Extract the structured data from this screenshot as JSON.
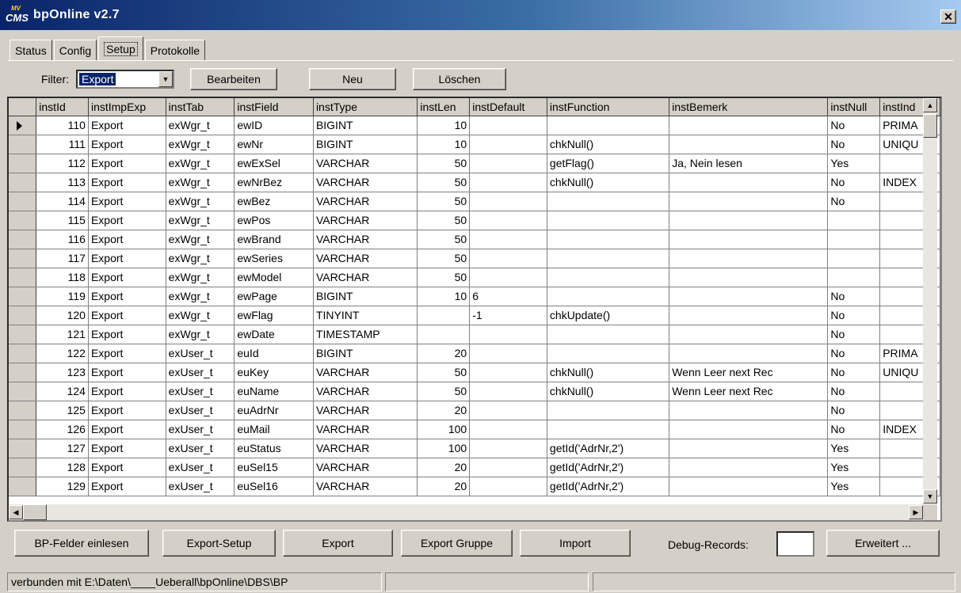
{
  "window": {
    "title": "bpOnline v2.7",
    "close_glyph": "✕",
    "logo_text": "CMS",
    "logo_top": "MV"
  },
  "tabs": [
    "Status",
    "Config",
    "Setup",
    "Protokolle"
  ],
  "toolbar": {
    "filter_label": "Filter:",
    "filter_value": "Export",
    "edit_label": "Bearbeiten",
    "new_label": "Neu",
    "delete_label": "Löschen"
  },
  "grid": {
    "columns": [
      "instId",
      "instImpExp",
      "instTab",
      "instField",
      "instType",
      "instLen",
      "instDefault",
      "instFunction",
      "instBemerk",
      "instNull",
      "instInd"
    ],
    "rows": [
      [
        "110",
        "Export",
        "exWgr_t",
        "ewID",
        "BIGINT",
        "10",
        "",
        "",
        "",
        "No",
        "PRIMA"
      ],
      [
        "111",
        "Export",
        "exWgr_t",
        "ewNr",
        "BIGINT",
        "10",
        "",
        "chkNull()",
        "",
        "No",
        "UNIQU"
      ],
      [
        "112",
        "Export",
        "exWgr_t",
        "ewExSel",
        "VARCHAR",
        "50",
        "",
        "getFlag()",
        "Ja, Nein lesen",
        "Yes",
        ""
      ],
      [
        "113",
        "Export",
        "exWgr_t",
        "ewNrBez",
        "VARCHAR",
        "50",
        "",
        "chkNull()",
        "",
        "No",
        "INDEX"
      ],
      [
        "114",
        "Export",
        "exWgr_t",
        "ewBez",
        "VARCHAR",
        "50",
        "",
        "",
        "",
        "No",
        ""
      ],
      [
        "115",
        "Export",
        "exWgr_t",
        "ewPos",
        "VARCHAR",
        "50",
        "",
        "",
        "",
        "",
        ""
      ],
      [
        "116",
        "Export",
        "exWgr_t",
        "ewBrand",
        "VARCHAR",
        "50",
        "",
        "",
        "",
        "",
        ""
      ],
      [
        "117",
        "Export",
        "exWgr_t",
        "ewSeries",
        "VARCHAR",
        "50",
        "",
        "",
        "",
        "",
        ""
      ],
      [
        "118",
        "Export",
        "exWgr_t",
        "ewModel",
        "VARCHAR",
        "50",
        "",
        "",
        "",
        "",
        ""
      ],
      [
        "119",
        "Export",
        "exWgr_t",
        "ewPage",
        "BIGINT",
        "10",
        "6",
        "",
        "",
        "No",
        ""
      ],
      [
        "120",
        "Export",
        "exWgr_t",
        "ewFlag",
        "TINYINT",
        "",
        "-1",
        "chkUpdate()",
        "",
        "No",
        ""
      ],
      [
        "121",
        "Export",
        "exWgr_t",
        "ewDate",
        "TIMESTAMP",
        "",
        "",
        "",
        "",
        "No",
        ""
      ],
      [
        "122",
        "Export",
        "exUser_t",
        "euId",
        "BIGINT",
        "20",
        "",
        "",
        "",
        "No",
        "PRIMA"
      ],
      [
        "123",
        "Export",
        "exUser_t",
        "euKey",
        "VARCHAR",
        "50",
        "",
        "chkNull()",
        "Wenn Leer next Rec",
        "No",
        "UNIQU"
      ],
      [
        "124",
        "Export",
        "exUser_t",
        "euName",
        "VARCHAR",
        "50",
        "",
        "chkNull()",
        "Wenn Leer next Rec",
        "No",
        ""
      ],
      [
        "125",
        "Export",
        "exUser_t",
        "euAdrNr",
        "VARCHAR",
        "20",
        "",
        "",
        "",
        "No",
        ""
      ],
      [
        "126",
        "Export",
        "exUser_t",
        "euMail",
        "VARCHAR",
        "100",
        "",
        "",
        "",
        "No",
        "INDEX"
      ],
      [
        "127",
        "Export",
        "exUser_t",
        "euStatus",
        "VARCHAR",
        "100",
        "",
        "getId('AdrNr,2')",
        "",
        "Yes",
        ""
      ],
      [
        "128",
        "Export",
        "exUser_t",
        "euSel15",
        "VARCHAR",
        "20",
        "",
        "getId('AdrNr,2')",
        "",
        "Yes",
        ""
      ],
      [
        "129",
        "Export",
        "exUser_t",
        "euSel16",
        "VARCHAR",
        "20",
        "",
        "getId('AdrNr,2')",
        "",
        "Yes",
        ""
      ]
    ]
  },
  "bottom": {
    "read_fields_label": "BP-Felder einlesen",
    "export_setup_label": "Export-Setup",
    "export_label": "Export",
    "export_group_label": "Export Gruppe",
    "import_label": "Import",
    "debug_label": "Debug-Records:",
    "debug_value": "",
    "advanced_label": "Erweitert ..."
  },
  "status": {
    "connection": "verbunden mit E:\\Daten\\____Ueberall\\bpOnline\\DBS\\BP",
    "pane2": "",
    "pane3": ""
  }
}
